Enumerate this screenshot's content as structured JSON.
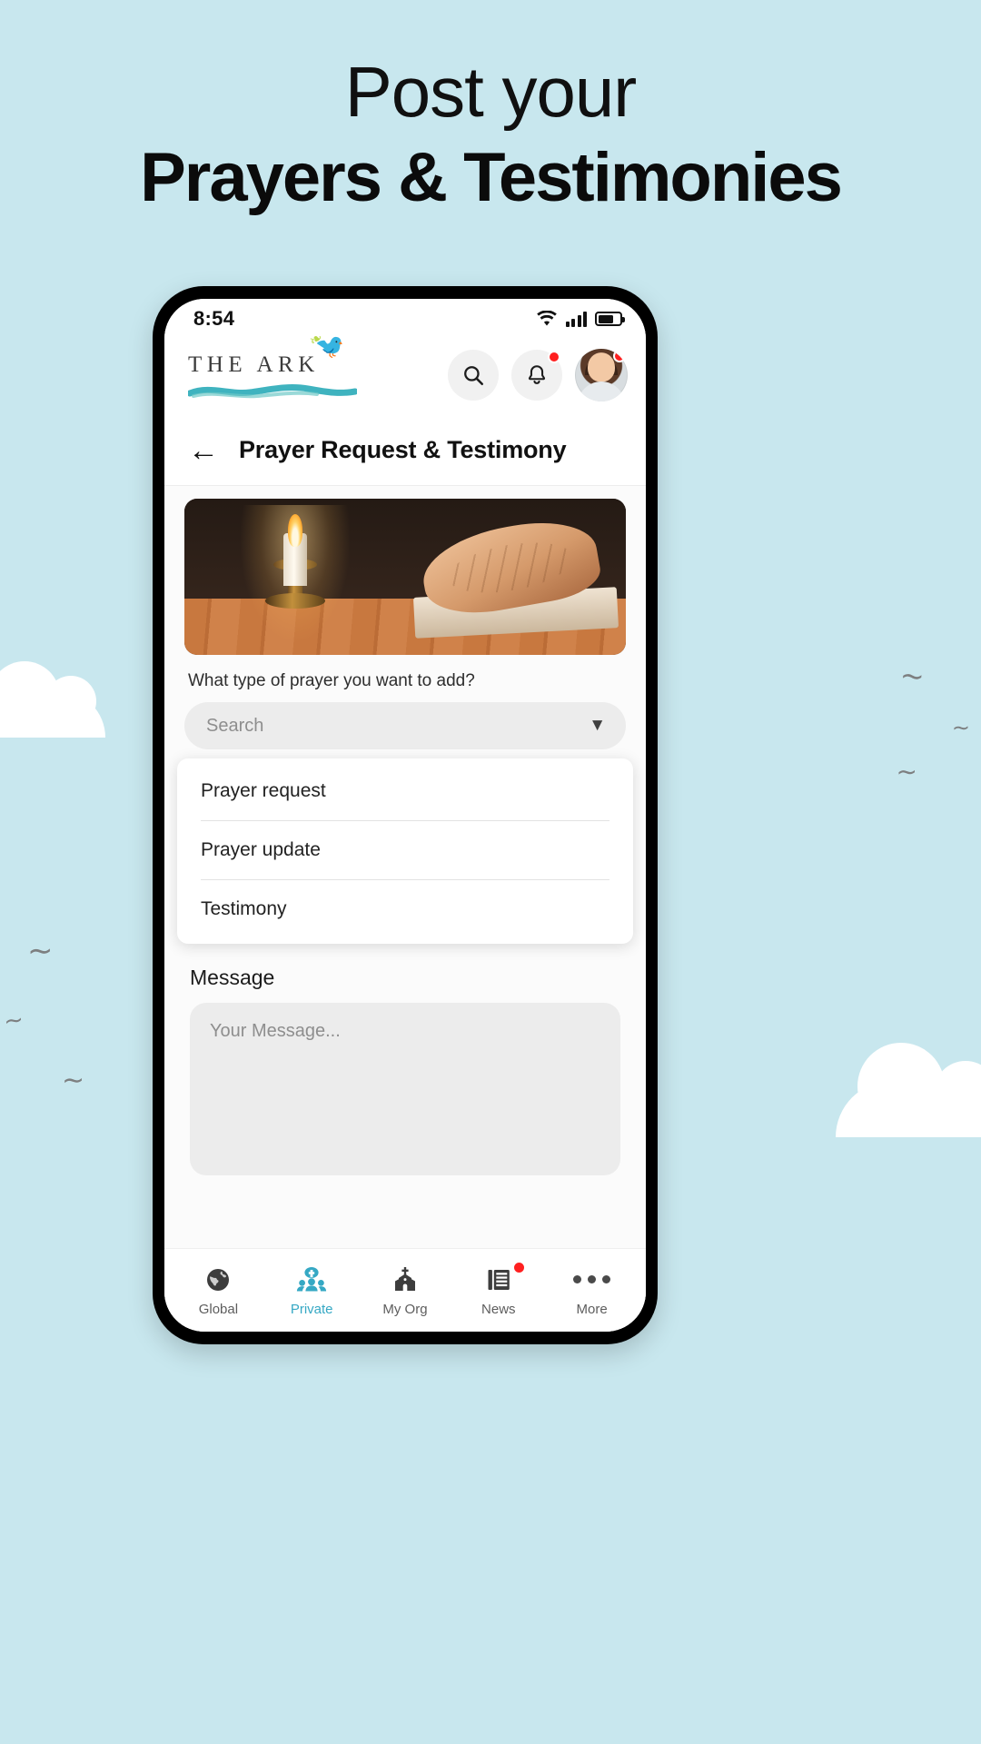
{
  "promo": {
    "line1": "Post your",
    "line2": "Prayers & Testimonies",
    "background_color": "#c8e7ee"
  },
  "phone": {
    "status_bar": {
      "time": "8:54",
      "wifi_icon": "wifi-icon",
      "signal_icon": "cellular-signal-icon",
      "battery_icon": "battery-icon"
    },
    "app_header": {
      "brand_name": "THE ARK",
      "brand_bird_icon": "dove-icon",
      "brand_leaf_icon": "olive-leaf-icon",
      "search_icon": "search-icon",
      "bell_icon": "bell-icon",
      "avatar_icon": "user-avatar",
      "notification_badge": "",
      "accent_color": "#35a8c4"
    },
    "sub_header": {
      "back_icon": "back-arrow-icon",
      "title": "Prayer Request & Testimony"
    },
    "form": {
      "hero_image_alt": "candle-and-praying-hands-photo",
      "type_question": "What type of prayer you want to add?",
      "select_placeholder": "Search",
      "select_caret_icon": "chevron-down-icon",
      "dropdown_options": [
        "Prayer request",
        "Prayer update",
        "Testimony"
      ],
      "message_label": "Message",
      "message_placeholder": "Your Message..."
    },
    "bottom_nav": {
      "items": [
        {
          "label": "Global",
          "icon": "globe-icon",
          "active": false,
          "badge": false
        },
        {
          "label": "Private",
          "icon": "group-people-icon",
          "active": true,
          "badge": false
        },
        {
          "label": "My Org",
          "icon": "church-icon",
          "active": false,
          "badge": false
        },
        {
          "label": "News",
          "icon": "news-icon",
          "active": false,
          "badge": true
        },
        {
          "label": "More",
          "icon": "ellipsis-icon",
          "active": false,
          "badge": false
        }
      ]
    }
  }
}
